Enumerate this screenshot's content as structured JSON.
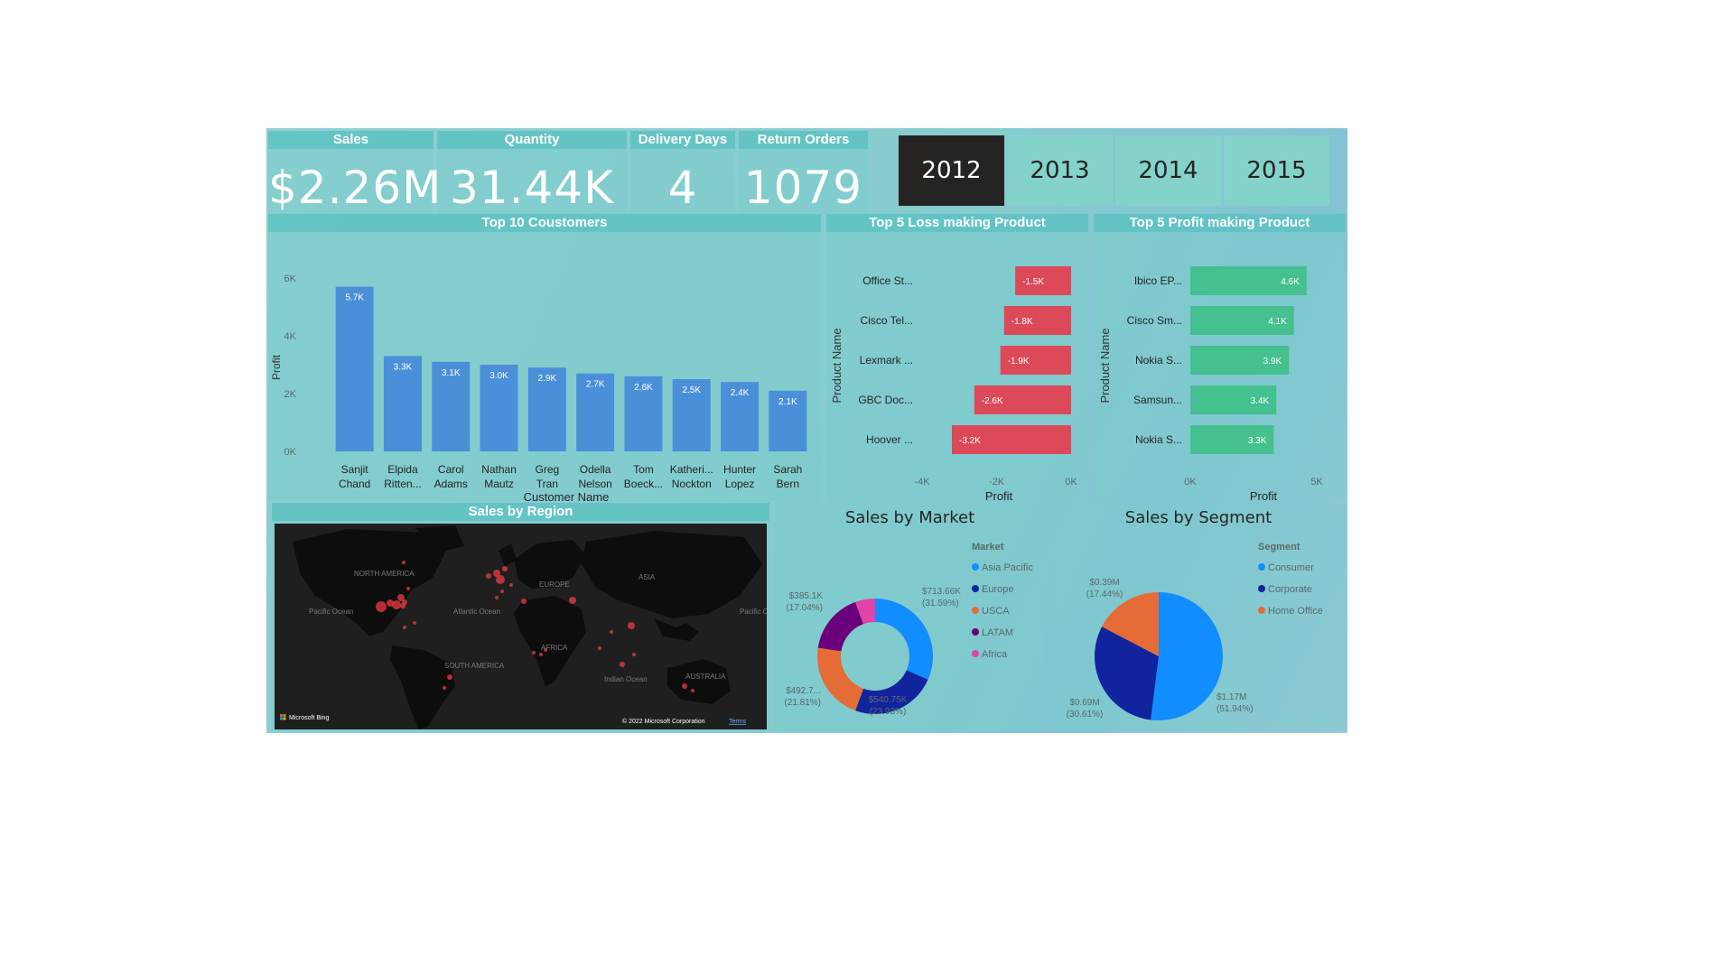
{
  "kpis": {
    "sales": {
      "label": "Sales",
      "value": "$2.26M"
    },
    "quantity": {
      "label": "Quantity",
      "value": "31.44K"
    },
    "delivery": {
      "label": "Delivery Days",
      "value": "4"
    },
    "returns": {
      "label": "Return Orders",
      "value": "1079"
    }
  },
  "years": [
    "2012",
    "2013",
    "2014",
    "2015"
  ],
  "selected_year": "2012",
  "map": {
    "title": "Sales by Region",
    "labels": [
      "NORTH AMERICA",
      "EUROPE",
      "ASIA",
      "AFRICA",
      "SOUTH AMERICA",
      "AUSTRALIA",
      "Pacific Ocean",
      "Atlantic Ocean",
      "Indian Ocean",
      "Pacific Ocean"
    ],
    "logo": "Microsoft Bing",
    "copyright": "© 2022 Microsoft Corporation",
    "terms": "Terms"
  },
  "chart_data": [
    {
      "type": "bar",
      "title": "Top 10 Coustomers",
      "xlabel": "Customer Name",
      "ylabel": "Profit",
      "ylim": [
        0,
        6000
      ],
      "yticks": [
        "0K",
        "2K",
        "4K",
        "6K"
      ],
      "categories": [
        "Sanjit Chand",
        "Elpida Ritten...",
        "Carol Adams",
        "Nathan Mautz",
        "Greg Tran",
        "Odella Nelson",
        "Tom Boeck...",
        "Katheri... Nockton",
        "Hunter Lopez",
        "Sarah Bern"
      ],
      "values": [
        5700,
        3300,
        3100,
        3000,
        2900,
        2700,
        2600,
        2500,
        2400,
        2100
      ],
      "data_labels": [
        "5.7K",
        "3.3K",
        "3.1K",
        "3.0K",
        "2.9K",
        "2.7K",
        "2.6K",
        "2.5K",
        "2.4K",
        "2.1K"
      ],
      "color": "#4a90d9"
    },
    {
      "type": "bar",
      "orientation": "horizontal",
      "title": "Top 5 Loss making Product",
      "xlabel": "Profit",
      "ylabel": "Product Name",
      "xlim": [
        -4000,
        0
      ],
      "xticks": [
        "-4K",
        "-2K",
        "0K"
      ],
      "categories": [
        "Office St...",
        "Cisco Tel...",
        "Lexmark ...",
        "GBC Doc...",
        "Hoover ..."
      ],
      "values": [
        -1500,
        -1800,
        -1900,
        -2600,
        -3200
      ],
      "data_labels": [
        "-1.5K",
        "-1.8K",
        "-1.9K",
        "-2.6K",
        "-3.2K"
      ],
      "color": "#dc4a5a"
    },
    {
      "type": "bar",
      "orientation": "horizontal",
      "title": "Top 5 Profit making Product",
      "xlabel": "Profit",
      "ylabel": "Product Name",
      "xlim": [
        0,
        5000
      ],
      "xticks": [
        "0K",
        "5K"
      ],
      "categories": [
        "Ibico EP...",
        "Cisco Sm...",
        "Nokia S...",
        "Samsun...",
        "Nokia S..."
      ],
      "values": [
        4600,
        4100,
        3900,
        3400,
        3300
      ],
      "data_labels": [
        "4.6K",
        "4.1K",
        "3.9K",
        "3.4K",
        "3.3K"
      ],
      "color": "#45c08f"
    },
    {
      "type": "pie",
      "donut": true,
      "title": "Sales by Market",
      "legend_title": "Market",
      "legend_position": "right",
      "labels": [
        "Asia Pacific",
        "Europe",
        "USCA",
        "LATAM",
        "Africa"
      ],
      "values": [
        713.66,
        540.75,
        492.7,
        385.1,
        125.9
      ],
      "data_labels": [
        [
          "$713.66K",
          "(31.59%)"
        ],
        [
          "$540.75K",
          "(23.93%)"
        ],
        [
          "$492.7...",
          "(21.81%)"
        ],
        [
          "$385.1K",
          "(17.04%)"
        ]
      ],
      "colors": [
        "#118dff",
        "#12239e",
        "#e66c37",
        "#6b007b",
        "#e044a7"
      ]
    },
    {
      "type": "pie",
      "title": "Sales by Segment",
      "legend_title": "Segment",
      "legend_position": "right",
      "labels": [
        "Consumer",
        "Corporate",
        "Home Office"
      ],
      "values": [
        1.17,
        0.69,
        0.39
      ],
      "data_labels": [
        [
          "$1.17M",
          "(51.94%)"
        ],
        [
          "$0.69M",
          "(30.61%)"
        ],
        [
          "$0.39M",
          "(17.44%)"
        ]
      ],
      "colors": [
        "#118dff",
        "#12239e",
        "#e66c37"
      ]
    }
  ]
}
